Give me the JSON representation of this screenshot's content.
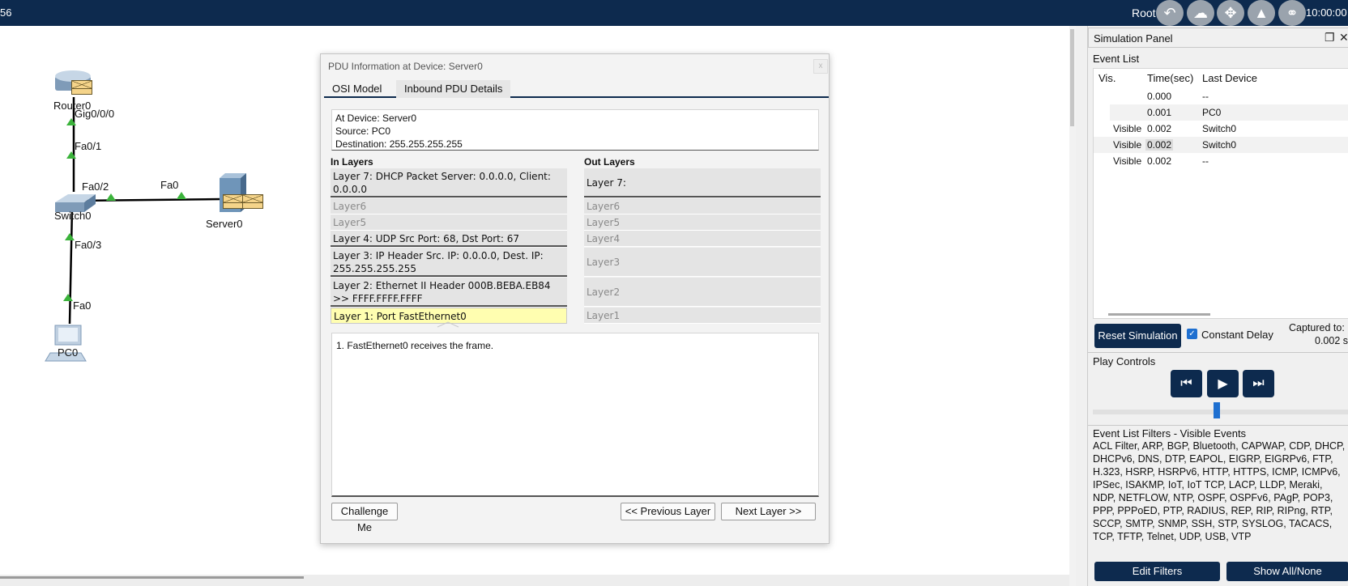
{
  "topbar": {
    "left_text": "56",
    "user": "Root",
    "icons": [
      "undo-icon",
      "cloud-download-icon",
      "move-icon",
      "landscape-icon",
      "network-globe-icon"
    ],
    "clock": "10:00:00"
  },
  "workspace": {
    "devices": {
      "router": "Router0",
      "switch": "Switch0",
      "server": "Server0",
      "pc": "PC0"
    },
    "ports": {
      "router_gig": "Gig0/0/0",
      "switch_fa01": "Fa0/1",
      "switch_fa02": "Fa0/2",
      "server_fa0": "Fa0",
      "switch_fa03": "Fa0/3",
      "pc_fa0": "Fa0"
    }
  },
  "pdu_dialog": {
    "title": "PDU Information at Device: Server0",
    "close": "x",
    "tabs": [
      "OSI Model",
      "Inbound PDU Details"
    ],
    "info": {
      "device": "At Device: Server0",
      "source": "Source: PC0",
      "destination": "Destination: 255.255.255.255"
    },
    "in_layers_label": "In Layers",
    "out_layers_label": "Out Layers",
    "in_layers": [
      "Layer 7: DHCP Packet Server: 0.0.0.0, Client: 0.0.0.0",
      "Layer6",
      "Layer5",
      "Layer 4: UDP Src Port: 68, Dst Port: 67",
      "Layer 3: IP Header Src. IP: 0.0.0.0, Dest. IP: 255.255.255.255",
      "Layer 2: Ethernet II Header 000B.BEBA.EB84 >> FFFF.FFFF.FFFF",
      "Layer 1: Port FastEthernet0"
    ],
    "out_layers": [
      "Layer 7:",
      "Layer6",
      "Layer5",
      "Layer4",
      "Layer3",
      "Layer2",
      "Layer1"
    ],
    "description": "1. FastEthernet0 receives the frame.",
    "buttons": {
      "challenge": "Challenge Me",
      "previous": "<< Previous Layer",
      "next": "Next Layer >>"
    }
  },
  "simulation_panel": {
    "title": "Simulation Panel",
    "event_list_label": "Event List",
    "columns": [
      "Vis.",
      "Time(sec)",
      "Last Device"
    ],
    "events": [
      {
        "vis": "",
        "time": "0.000",
        "device": "--"
      },
      {
        "vis": "",
        "time": "0.001",
        "device": "PC0"
      },
      {
        "vis": "Visible",
        "time": "0.002",
        "device": "Switch0"
      },
      {
        "vis": "Visible",
        "time": "0.002",
        "device": "Switch0"
      },
      {
        "vis": "Visible",
        "time": "0.002",
        "device": "--"
      }
    ],
    "reset_button": "Reset Simulation",
    "constant_delay": "Constant Delay",
    "constant_delay_checked": true,
    "captured_label": "Captured to:",
    "captured_value": "0.002 s",
    "play_controls_label": "Play Controls",
    "filters_label": "Event List Filters - Visible Events",
    "filters": "ACL Filter, ARP, BGP, Bluetooth, CAPWAP, CDP, DHCP, DHCPv6, DNS, DTP, EAPOL, EIGRP, EIGRPv6, FTP, H.323, HSRP, HSRPv6, HTTP, HTTPS, ICMP, ICMPv6, IPSec, ISAKMP, IoT, IoT TCP, LACP, LLDP, Meraki, NDP, NETFLOW, NTP, OSPF, OSPFv6, PAgP, POP3, PPP, PPPoED, PTP, RADIUS, REP, RIP, RIPng, RTP, SCCP, SMTP, SNMP, SSH, STP, SYSLOG, TACACS, TCP, TFTP, Telnet, UDP, USB, VTP",
    "edit_filters": "Edit Filters",
    "show_all": "Show All/None"
  },
  "colors": {
    "navy": "#0d2a4e",
    "selected_layer": "#fffeb0",
    "link_arrow": "#3bb33b"
  }
}
